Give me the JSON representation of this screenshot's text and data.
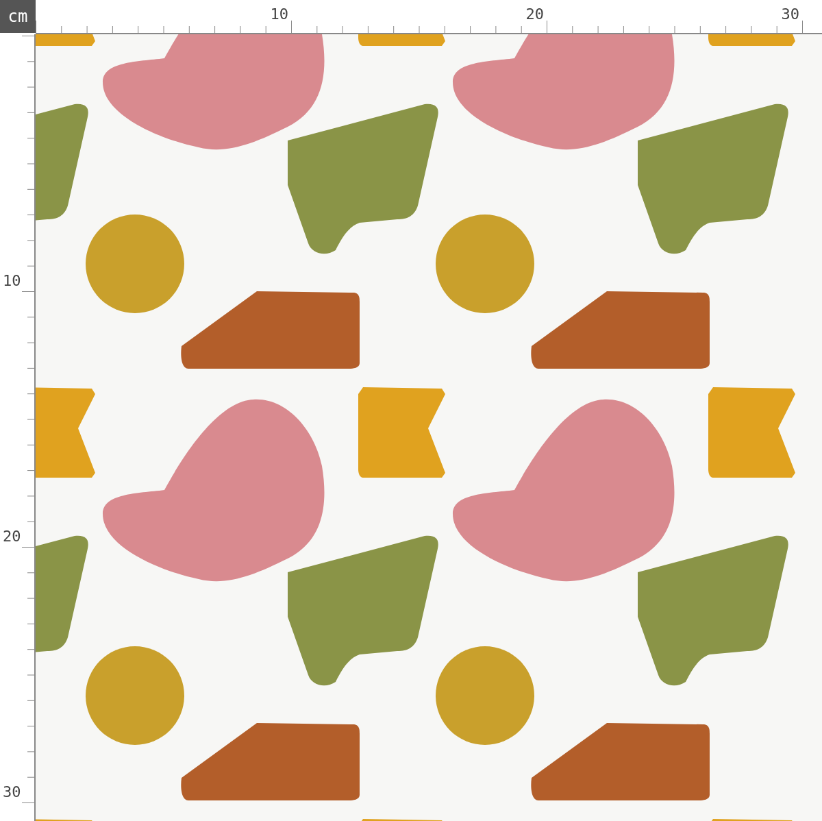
{
  "unit_label": "cm",
  "top_ruler": {
    "labels": [
      "10",
      "20",
      "30"
    ]
  },
  "left_ruler": {
    "labels": [
      "10",
      "20",
      "30"
    ]
  }
}
